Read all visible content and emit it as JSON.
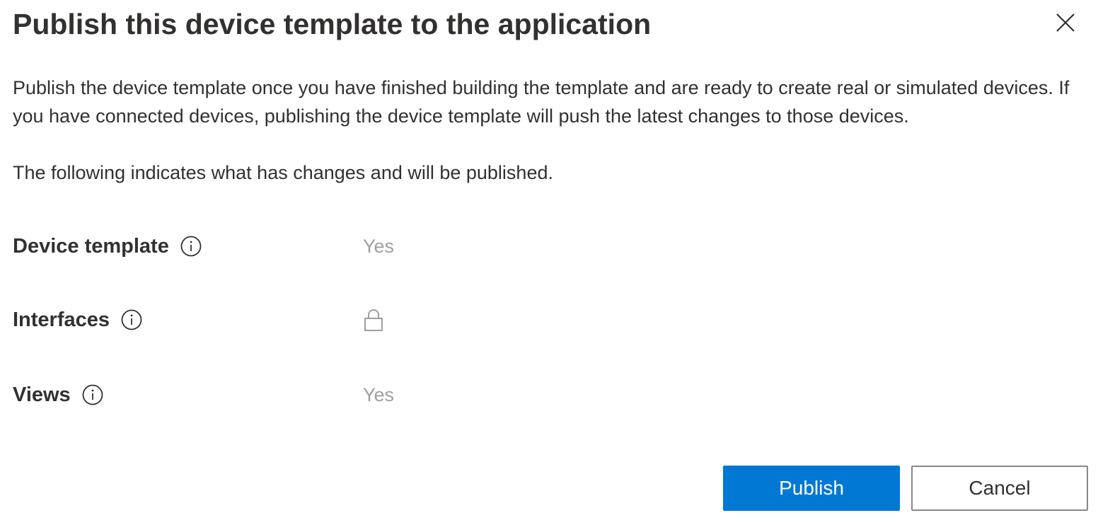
{
  "dialog": {
    "title": "Publish this device template to the application",
    "description": "Publish the device template once you have finished building the template and are ready to create real or simulated devices. If you have connected devices, publishing the device template will push the latest changes to those devices.",
    "subdescription": "The following indicates what has changes and will be published.",
    "rows": [
      {
        "label": "Device template",
        "value": "Yes",
        "icon": "info-icon"
      },
      {
        "label": "Interfaces",
        "value": "",
        "value_icon": "lock-icon",
        "icon": "info-icon"
      },
      {
        "label": "Views",
        "value": "Yes",
        "icon": "info-icon"
      }
    ],
    "actions": {
      "publish_label": "Publish",
      "cancel_label": "Cancel"
    },
    "close_icon": "close-icon"
  },
  "colors": {
    "primary": "#0078d4",
    "text": "#323130",
    "muted": "#a19f9d",
    "border": "#8a8886"
  }
}
